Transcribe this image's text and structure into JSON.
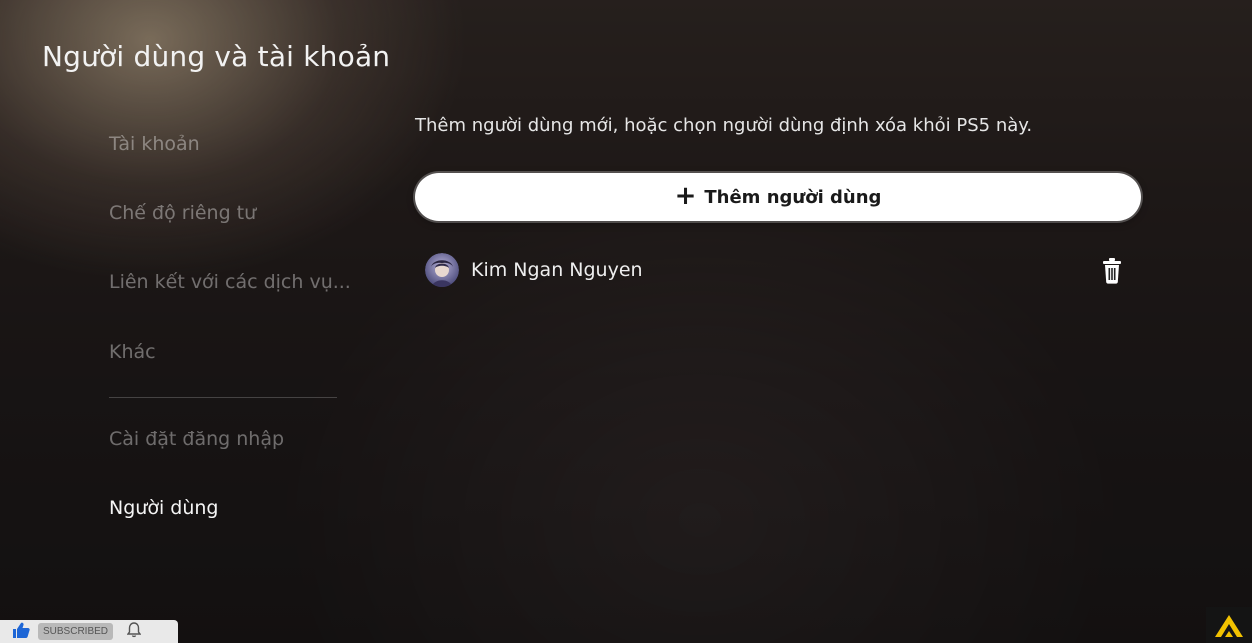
{
  "page": {
    "title": "Người dùng và tài khoản"
  },
  "sidebar": {
    "items": [
      {
        "label": "Tài khoản",
        "active": false
      },
      {
        "label": "Chế độ riêng tư",
        "active": false
      },
      {
        "label": "Liên kết với các dịch vụ...",
        "active": false
      },
      {
        "label": "Khác",
        "active": false
      },
      {
        "label": "Cài đặt đăng nhập",
        "active": false
      },
      {
        "label": "Người dùng",
        "active": true
      }
    ]
  },
  "main": {
    "description": "Thêm người dùng mới, hoặc chọn người dùng định xóa khỏi PS5 này.",
    "add_user_label": "Thêm người dùng",
    "users": [
      {
        "name": "Kim Ngan Nguyen"
      }
    ]
  },
  "overlay": {
    "subscribed_label": "SUBSCRIBED"
  },
  "colors": {
    "accent_button": "#ffffff",
    "active_text": "#f5f5f5",
    "inactive_text": "rgba(255,255,255,0.38)",
    "logo_yellow": "#f2c200"
  },
  "icons": [
    "plus-icon",
    "trash-icon",
    "avatar",
    "like-icon",
    "bell-icon",
    "brand-logo"
  ]
}
